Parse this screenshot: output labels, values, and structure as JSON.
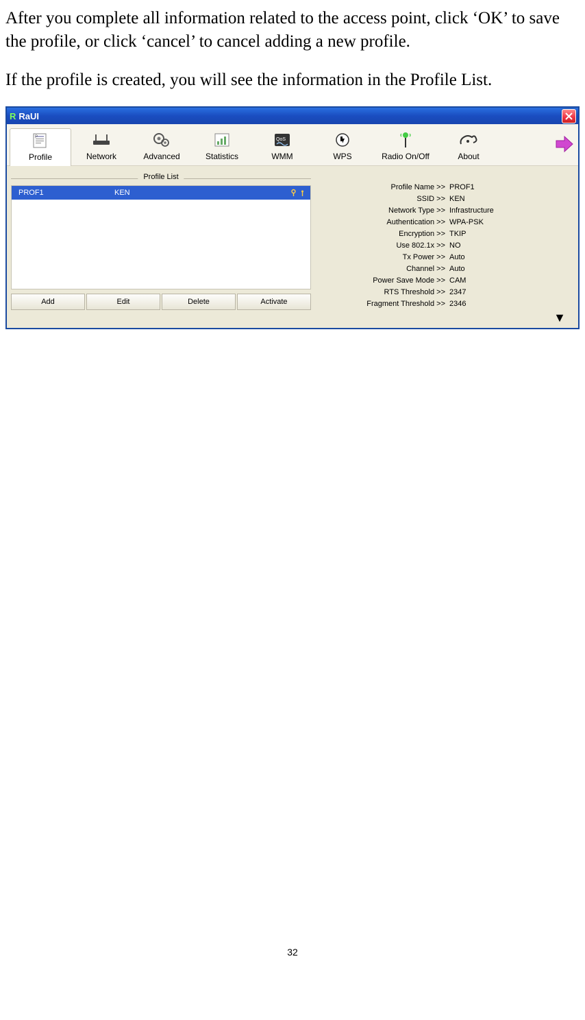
{
  "intro": {
    "p1": "After you complete all information related to the access point, click ‘OK’ to save the profile, or click ‘cancel’ to cancel adding a new profile.",
    "p2": "If the profile is created, you will see the information in the Profile List."
  },
  "window": {
    "title": "RaUI"
  },
  "toolbar": {
    "profile": "Profile",
    "network": "Network",
    "advanced": "Advanced",
    "statistics": "Statistics",
    "wmm": "WMM",
    "wps": "WPS",
    "radio": "Radio On/Off",
    "about": "About"
  },
  "profileList": {
    "header": "Profile List",
    "row": {
      "name": "PROF1",
      "ssid": "KEN"
    },
    "buttons": {
      "add": "Add",
      "edit": "Edit",
      "delete": "Delete",
      "activate": "Activate"
    }
  },
  "details": {
    "profileName": {
      "label": "Profile Name >>",
      "value": "PROF1"
    },
    "ssid": {
      "label": "SSID >>",
      "value": "KEN"
    },
    "networkType": {
      "label": "Network Type >>",
      "value": "Infrastructure"
    },
    "authentication": {
      "label": "Authentication >>",
      "value": "WPA-PSK"
    },
    "encryption": {
      "label": "Encryption >>",
      "value": "TKIP"
    },
    "use8021x": {
      "label": "Use 802.1x >>",
      "value": "NO"
    },
    "txPower": {
      "label": "Tx Power >>",
      "value": "Auto"
    },
    "channel": {
      "label": "Channel >>",
      "value": "Auto"
    },
    "powerSave": {
      "label": "Power Save Mode >>",
      "value": "CAM"
    },
    "rts": {
      "label": "RTS Threshold >>",
      "value": "2347"
    },
    "fragment": {
      "label": "Fragment Threshold >>",
      "value": "2346"
    }
  },
  "pageNumber": "32"
}
